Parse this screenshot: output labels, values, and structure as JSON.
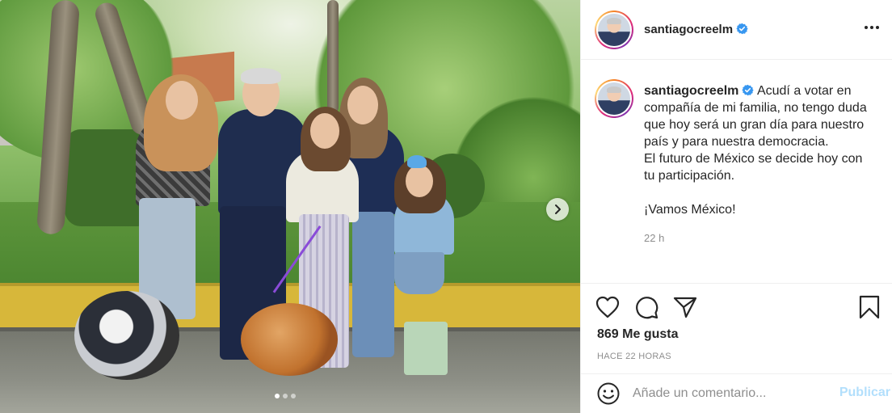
{
  "photo": {
    "image_label": "",
    "carousel_dots": 3,
    "active_dot": 1
  },
  "header": {
    "username": "santiagocreelm",
    "verified": true,
    "more_icon": "more-horizontal-icon"
  },
  "caption": {
    "username": "santiagocreelm",
    "lines": [
      "Acudí a votar en compañía de mi familia, no tengo duda que hoy será un gran día para nuestro país y para nuestra democracia.",
      "El futuro de México se decide hoy con tu participación.",
      "",
      "¡Vamos México!"
    ],
    "time": "22 h"
  },
  "actions": {
    "like_icon": "heart-icon",
    "comment_icon": "comment-icon",
    "share_icon": "share-icon",
    "save_icon": "bookmark-icon",
    "likes": "869 Me gusta",
    "posted_ago": "HACE 22 HORAS"
  },
  "comment": {
    "placeholder": "Añade un comentario...",
    "publish_label": "Publicar",
    "emoji_icon": "emoji-icon"
  },
  "colors": {
    "accent_blue": "#0095f6",
    "publish_disabled": "#b2dffc",
    "text": "#262626",
    "muted": "#8e8e8e",
    "verified": "#3897f0"
  }
}
